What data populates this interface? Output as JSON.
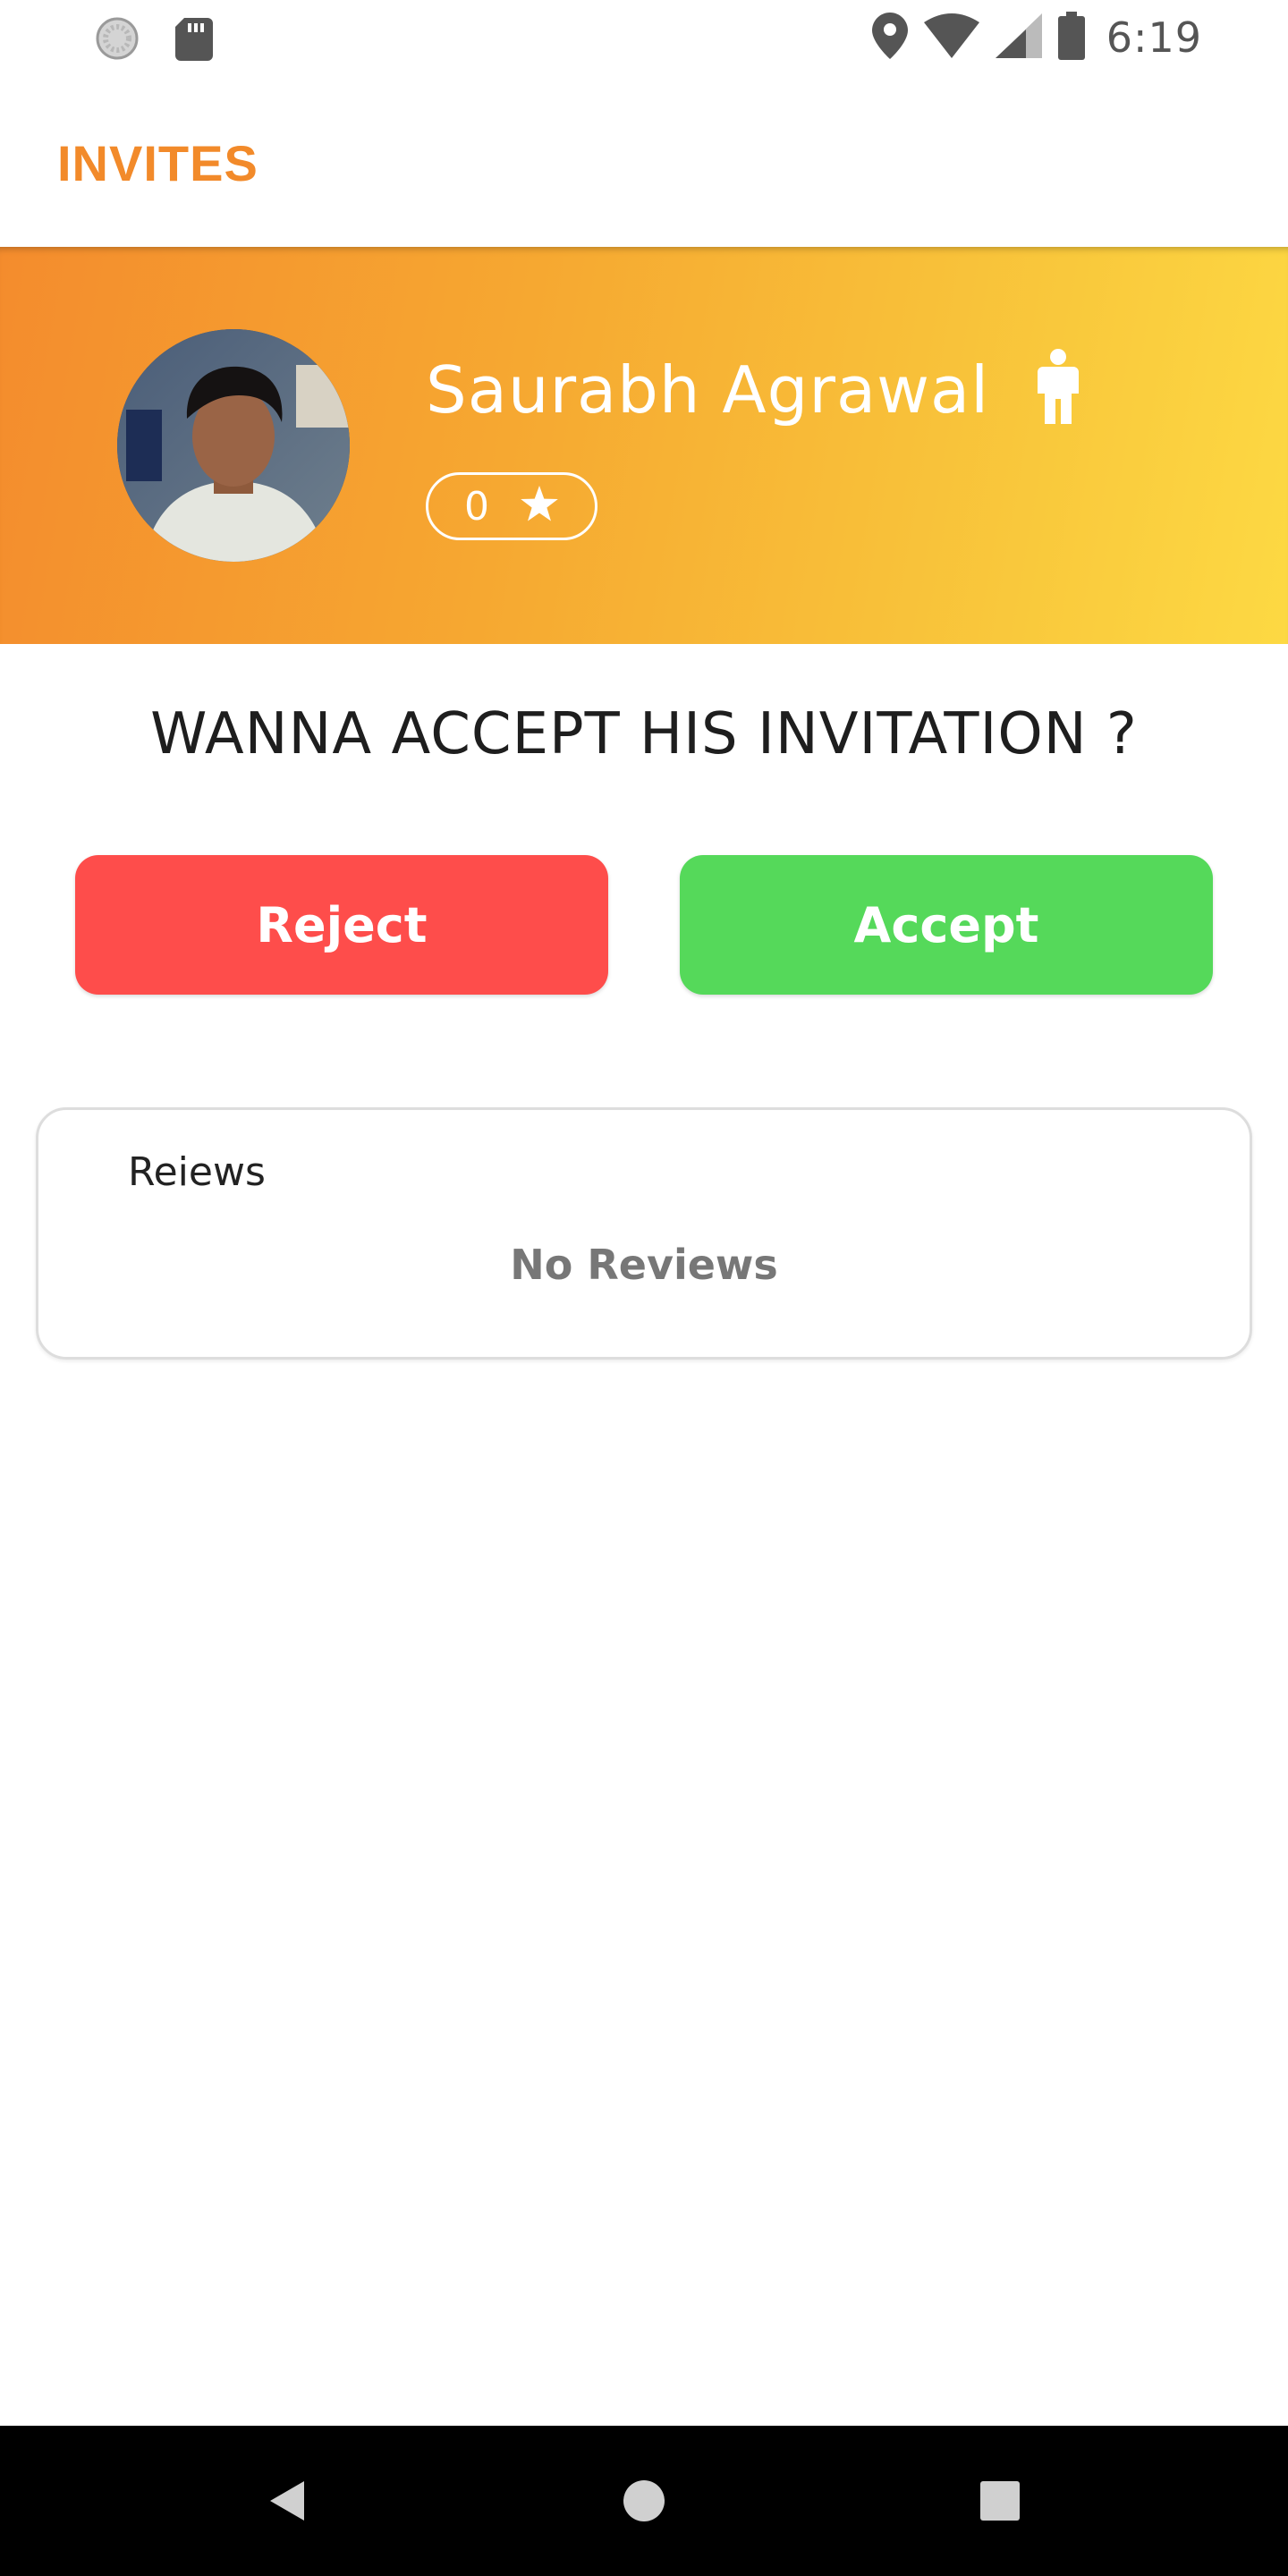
{
  "status_bar": {
    "time": "6:19",
    "left_icons": [
      "loading-indicator-icon",
      "sd-card-icon"
    ],
    "right_icons": [
      "location-icon",
      "wifi-icon",
      "cell-signal-icon",
      "battery-icon"
    ]
  },
  "app_bar": {
    "title": "INVITES"
  },
  "profile": {
    "name": "Saurabh Agrawal",
    "gender_icon": "male-icon",
    "rating": "0",
    "rating_icon": "star-icon"
  },
  "invitation": {
    "question": "WANNA ACCEPT HIS INVITATION ?",
    "reject_label": "Reject",
    "accept_label": "Accept"
  },
  "reviews": {
    "title": "Reiews",
    "empty_text": "No Reviews"
  },
  "colors": {
    "accent": "#f28a2a",
    "reject": "#fe4d4b",
    "accept": "#55d95a",
    "header_gradient_start": "#f48c2d",
    "header_gradient_end": "#fdd943"
  },
  "nav_bar": {
    "icons": [
      "back-icon",
      "home-icon",
      "recents-icon"
    ]
  }
}
